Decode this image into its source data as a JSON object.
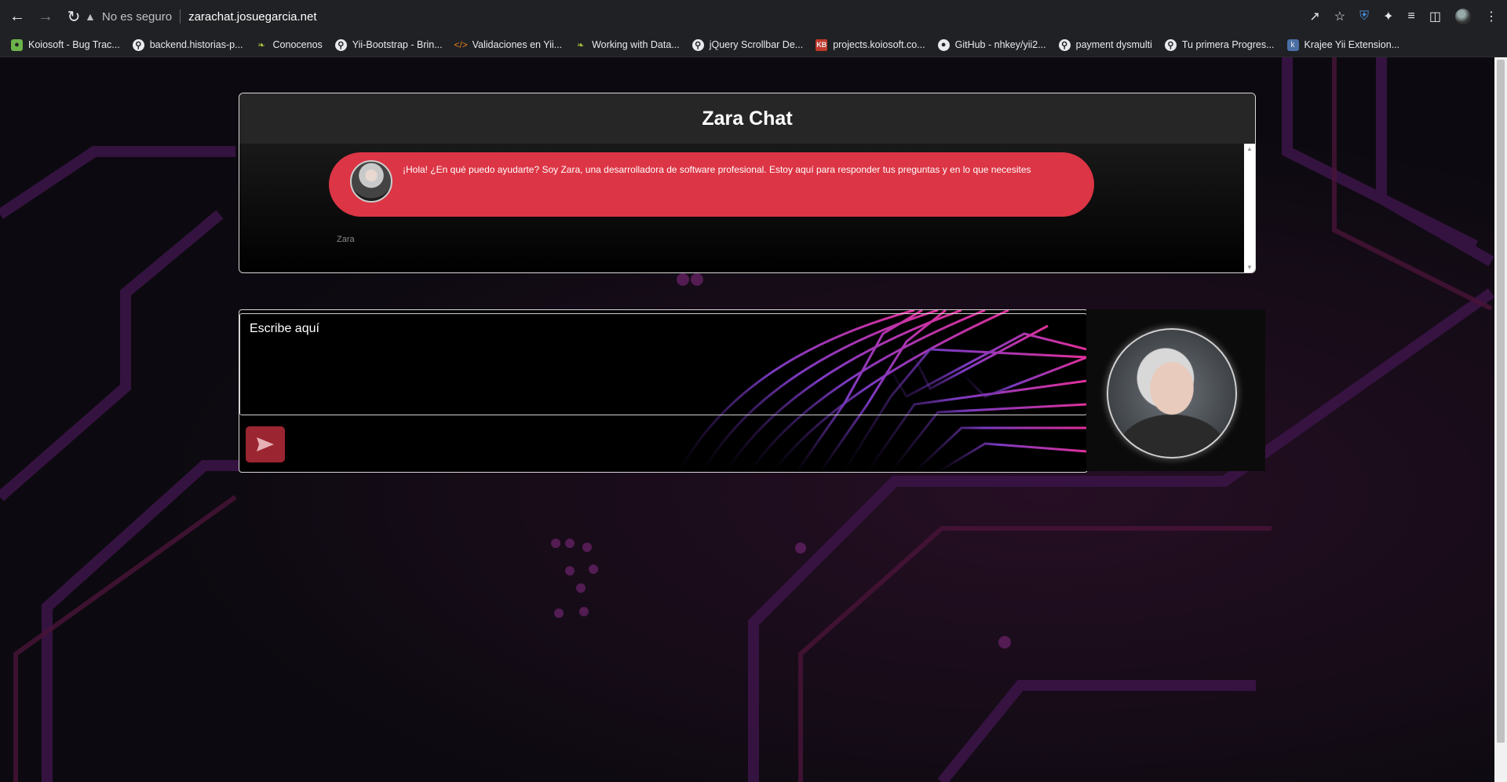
{
  "browser": {
    "security_label": "No es seguro",
    "url": "zarachat.josuegarcia.net",
    "bookmarks": [
      {
        "label": "Koiosoft - Bug Trac...",
        "icon": "bug-icon"
      },
      {
        "label": "backend.historias-p...",
        "icon": "globe-icon"
      },
      {
        "label": "Conocenos",
        "icon": "leaf-icon"
      },
      {
        "label": "Yii-Bootstrap - Brin...",
        "icon": "globe-icon"
      },
      {
        "label": "Validaciones en Yii...",
        "icon": "code-icon"
      },
      {
        "label": "Working with Data...",
        "icon": "leaf-icon"
      },
      {
        "label": "jQuery Scrollbar De...",
        "icon": "globe-icon"
      },
      {
        "label": "projects.koiosoft.co...",
        "icon": "kb-icon"
      },
      {
        "label": "GitHub - nhkey/yii2...",
        "icon": "github-icon"
      },
      {
        "label": "payment dysmulti",
        "icon": "globe-icon"
      },
      {
        "label": "Tu primera Progres...",
        "icon": "globe-icon"
      },
      {
        "label": "Krajee Yii Extension...",
        "icon": "krajee-icon"
      }
    ]
  },
  "chat": {
    "title": "Zara Chat",
    "messages": [
      {
        "text": "¡Hola! ¿En qué puedo ayudarte? Soy Zara, una desarrolladora de software profesional. Estoy aquí para responder tus preguntas y en lo que necesites",
        "sender": "Zara"
      }
    ],
    "input_placeholder": "Escribe aquí"
  },
  "colors": {
    "bubble": "#dc3545",
    "send_button": "#9b2530",
    "background": "#0c0a10",
    "accent_lines": "#e0309a"
  }
}
